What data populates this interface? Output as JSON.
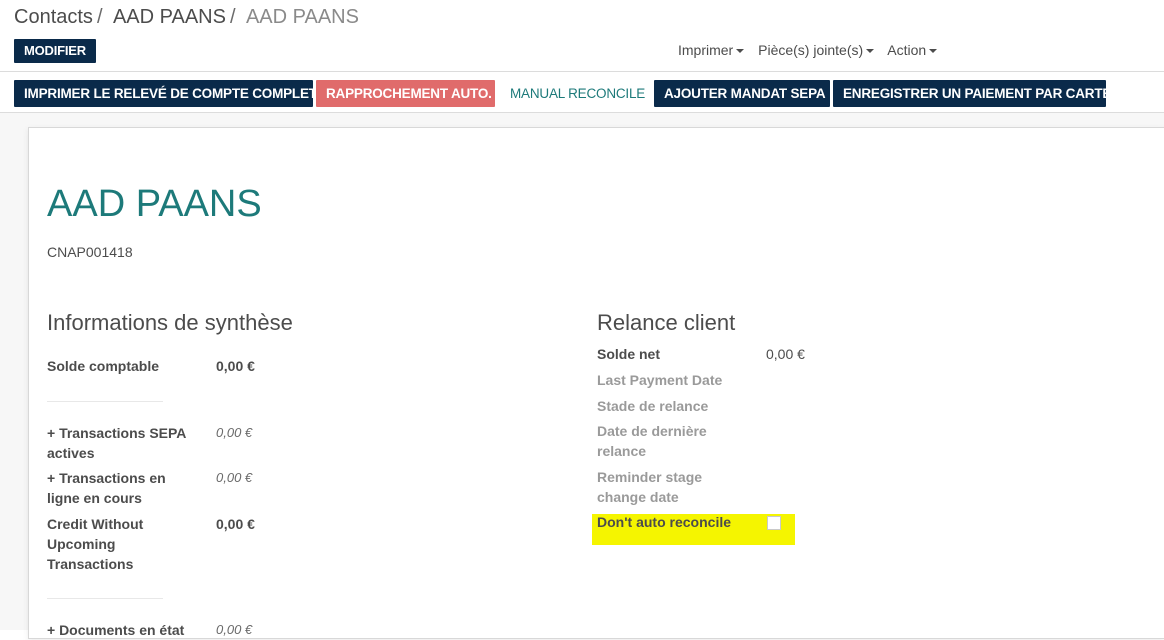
{
  "breadcrumb": [
    "Contacts",
    "AAD PAANS",
    "AAD PAANS"
  ],
  "breadcrumb_sep": "/",
  "edit_button": "MODIFIER",
  "dropdowns": [
    "Imprimer",
    "Pièce(s) jointe(s)",
    "Action"
  ],
  "action_buttons": [
    {
      "label": "IMPRIMER LE RELEVÉ DE COMPTE COMPLET",
      "style": "dark"
    },
    {
      "label": "RAPPROCHEMENT AUTO.",
      "style": "red"
    },
    {
      "label": "MANUAL RECONCILE",
      "style": "link"
    },
    {
      "label": "AJOUTER MANDAT SEPA",
      "style": "dark"
    },
    {
      "label": "ENREGISTRER UN PAIEMENT PAR CARTE",
      "style": "dark"
    }
  ],
  "record": {
    "name": "AAD PAANS",
    "reference": "CNAP001418"
  },
  "summary": {
    "title": "Informations de synthèse",
    "fields": [
      {
        "label": "Solde comptable",
        "value": "0,00 €"
      },
      {
        "label": "+ Transactions SEPA actives",
        "value": "0,00 €"
      },
      {
        "label": "+ Transactions en ligne en cours",
        "value": "0,00 €"
      },
      {
        "label": "Credit Without Upcoming Transactions",
        "value": "0,00 €"
      },
      {
        "label": "+ Documents en état",
        "value": "0,00 €"
      }
    ]
  },
  "dunning": {
    "title": "Relance client",
    "fields": [
      {
        "label": "Solde net",
        "value": "0,00 €"
      },
      {
        "label": "Last Payment Date",
        "value": ""
      },
      {
        "label": "Stade de relance",
        "value": ""
      },
      {
        "label": "Date de dernière relance",
        "value": ""
      },
      {
        "label": "Reminder stage change date",
        "value": ""
      },
      {
        "label": "Don't auto reconcile",
        "value": ""
      }
    ]
  },
  "colors": {
    "primary": "#0a2a4a",
    "danger": "#e06b6b",
    "accent": "#1d7a7a",
    "highlight": "#f5f500"
  }
}
